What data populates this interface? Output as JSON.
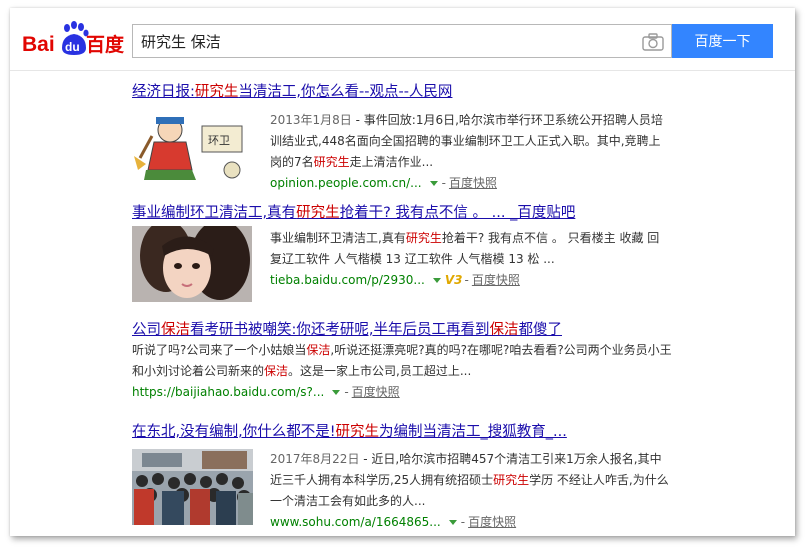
{
  "search": {
    "query": "研究生 保洁",
    "button_label": "百度一下"
  },
  "results": [
    {
      "title_parts": [
        "经济日报:",
        "研究生",
        "当清洁工,你怎么看--观点--人民网"
      ],
      "date": "2013年1月8日",
      "snippet_parts": [
        " - 事件回放:1月6日,哈尔滨市举行环卫系统公开招聘人员培训结业式,448名面向全国招聘的事业编制环卫工人正式入职。其中,竞聘上岗的7名",
        "研究生",
        "走上清洁作业..."
      ],
      "url": "opinion.people.com.cn/...",
      "snapshot": "百度快照",
      "thumb_sign": "环卫"
    },
    {
      "title_parts": [
        "事业编制环卫清洁工,真有",
        "研究生",
        "抢着干? 我有点不信 。 ... _百度贴吧"
      ],
      "snippet_parts": [
        "事业编制环卫清洁工,真有",
        "研究生",
        "抢着干? 我有点不信 。 只看楼主 收藏 回复辽工软件 人气楷模 13 辽工软件 人气楷模 13 松 ..."
      ],
      "url": "tieba.baidu.com/p/2930...",
      "badge": "V3",
      "snapshot": "百度快照"
    },
    {
      "title_parts": [
        "公司",
        "保洁",
        "看考研书被嘲笑:你还考研呢,半年后员工再看到",
        "保洁",
        "都傻了"
      ],
      "snippet_parts": [
        "听说了吗?公司来了一个小姑娘当",
        "保洁",
        ",听说还挺漂亮呢?真的吗?在哪呢?咱去看看?公司两个业务员小王和小刘讨论着公司新来的",
        "保洁",
        "。这是一家上市公司,员工超过上..."
      ],
      "url": "https://baijiahao.baidu.com/s?...",
      "snapshot": "百度快照"
    },
    {
      "title_parts": [
        "在东北,没有编制,你什么都不是!",
        "研究生",
        "为编制当清洁工_搜狐教育_..."
      ],
      "date": "2017年8月22日",
      "snippet_parts": [
        " - 近日,哈尔滨市招聘457个清洁工引来1万余人报名,其中近三千人拥有本科学历,25人拥有统招硕士",
        "研究生",
        "学历 不经让人咋舌,为什么一个清洁工会有如此多的人..."
      ],
      "url": "www.sohu.com/a/1664865...",
      "snapshot": "百度快照"
    }
  ],
  "colors": {
    "link": "#1a0dab",
    "highlight": "#cc0000",
    "url": "#008000",
    "button": "#3385ff",
    "logo_red": "#e10602",
    "logo_blue": "#2932e1"
  },
  "icons": {
    "logo": "baidu-paw-logo",
    "camera": "camera-icon",
    "dropdown": "green-down-arrow-icon",
    "badge": "v3-badge-icon"
  }
}
